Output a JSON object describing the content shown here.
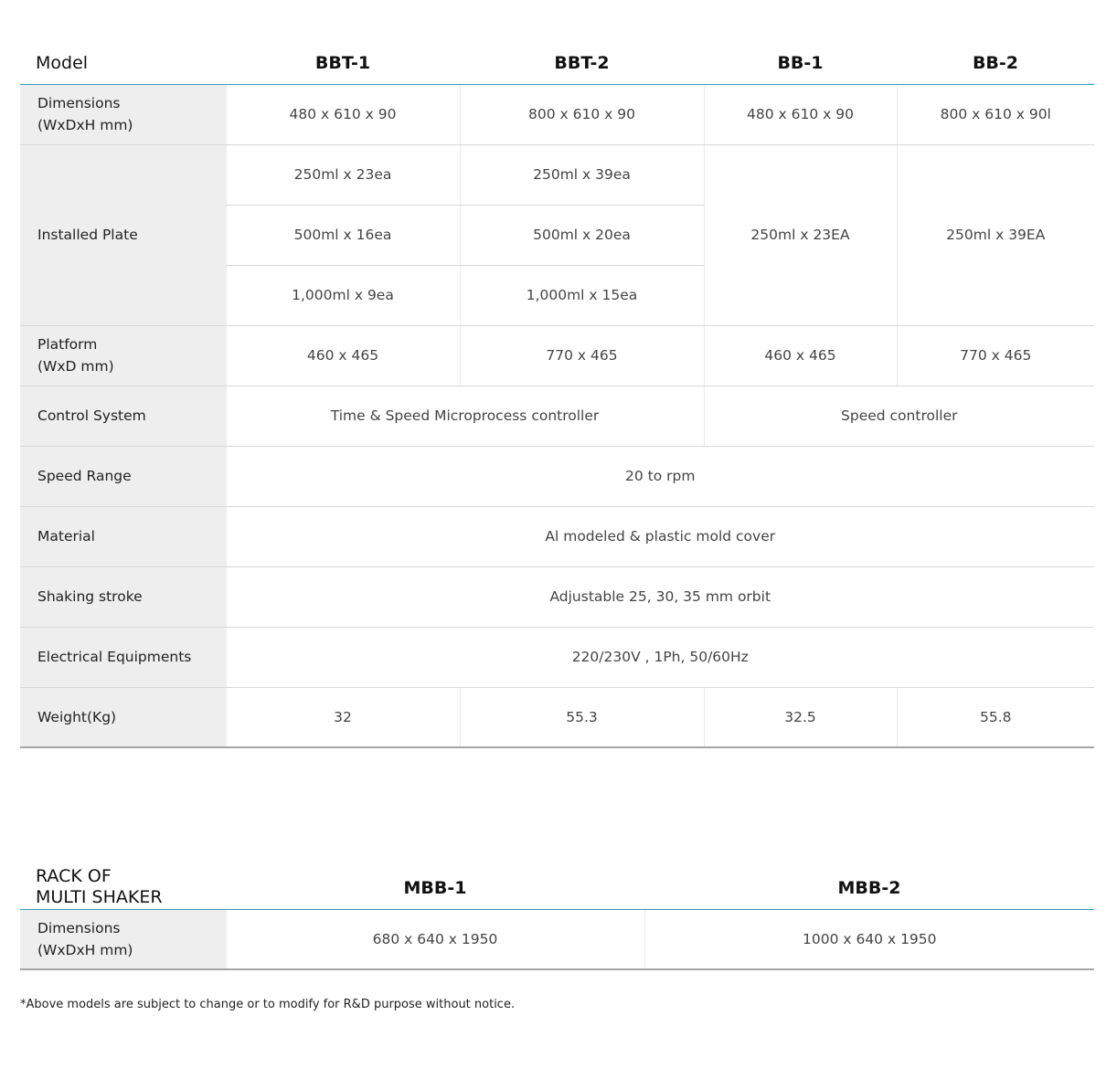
{
  "main_table": {
    "header": {
      "corner": "Model",
      "models": [
        "BBT-1",
        "BBT-2",
        "BB-1",
        "BB-2"
      ]
    },
    "dimensions": {
      "label_line1": "Dimensions",
      "label_line2": "(WxDxH mm)",
      "values": [
        "480 x 610 x 90",
        "800 x 610 x 90",
        "480 x 610 x 90",
        "800 x 610 x 90l"
      ]
    },
    "installed_plate": {
      "label": "Installed Plate",
      "bbt1": [
        "250ml x 23ea",
        "500ml x 16ea",
        "1,000ml x 9ea"
      ],
      "bbt2": [
        "250ml x 39ea",
        "500ml x 20ea",
        "1,000ml x 15ea"
      ],
      "bb1": "250ml x 23EA",
      "bb2": "250ml x 39EA"
    },
    "platform": {
      "label_line1": "Platform",
      "label_line2": "(WxD mm)",
      "values": [
        "460 x 465",
        "770 x 465",
        "460 x 465",
        "770 x 465"
      ]
    },
    "control_system": {
      "label": "Control System",
      "bbt": "Time & Speed Microprocess controller",
      "bb": "Speed controller"
    },
    "speed_range": {
      "label": "Speed Range",
      "value": "20 to rpm"
    },
    "material": {
      "label": "Material",
      "value": "Al modeled & plastic mold cover"
    },
    "shaking_stroke": {
      "label": "Shaking stroke",
      "value": "Adjustable 25, 30, 35 mm orbit"
    },
    "electrical": {
      "label": "Electrical Equipments",
      "value": "220/230V , 1Ph, 50/60Hz"
    },
    "weight": {
      "label": "Weight(Kg)",
      "values": [
        "32",
        "55.3",
        "32.5",
        "55.8"
      ]
    }
  },
  "rack_table": {
    "header": {
      "corner_line1": "RACK OF",
      "corner_line2": "MULTI SHAKER",
      "models": [
        "MBB-1",
        "MBB-2"
      ]
    },
    "dimensions": {
      "label_line1": "Dimensions",
      "label_line2": "(WxDxH mm)",
      "values": [
        "680 x 640 x 1950",
        "1000 x 640 x 1950"
      ]
    }
  },
  "footnote": "*Above models are subject to change or to modify for R&D purpose without notice.",
  "colors": {
    "header_rule": "#3a9bb5",
    "label_background": "#eeeeee",
    "row_divider": "#d8d8d8"
  }
}
